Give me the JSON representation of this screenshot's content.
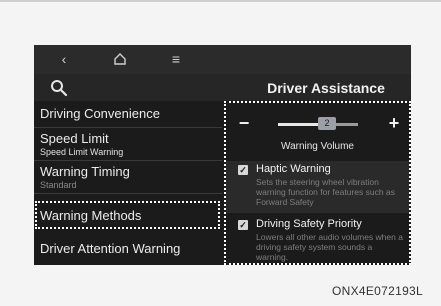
{
  "nav": {
    "back_icon": "back-chevron-icon",
    "home_icon": "home-icon",
    "menu_icon": "hamburger-menu-icon"
  },
  "header": {
    "title": "Driver Assistance",
    "search_icon": "search-icon"
  },
  "menu": {
    "items": [
      {
        "label": "Driving Convenience",
        "sub": ""
      },
      {
        "label": "Speed Limit",
        "sub": "Speed Limit Warning"
      },
      {
        "label": "Warning Timing",
        "sub": "Standard"
      },
      {
        "label": "Warning Methods",
        "sub": ""
      },
      {
        "label": "Driver Attention Warning",
        "sub": ""
      }
    ]
  },
  "panel": {
    "volume": {
      "minus": "−",
      "plus": "+",
      "value": "2",
      "level": 0.5,
      "label": "Warning Volume"
    },
    "options": [
      {
        "title": "Haptic Warning",
        "checked": true,
        "desc": "Sets the steering wheel vibration warning function for features such as Forward Safety"
      },
      {
        "title": "Driving Safety Priority",
        "checked": true,
        "desc": "Lowers all other audio volumes when a driving safety system sounds a warning."
      }
    ]
  },
  "caption": "ONX4E072193L",
  "colors": {
    "screen_bg": "#1b1b1b",
    "header_bg": "#262626",
    "navbar_bg": "#2b2b2b",
    "text": "#f2f2f2",
    "muted": "#7e7e7e"
  }
}
